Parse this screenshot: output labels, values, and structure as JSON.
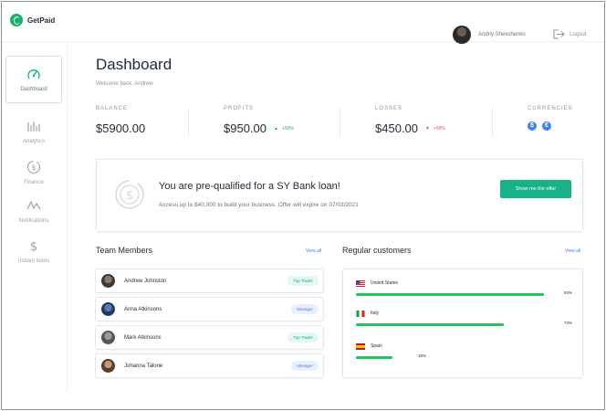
{
  "brand": {
    "name": "GetPaid"
  },
  "user": {
    "name": "Andriy Shevchenko"
  },
  "header": {
    "logout_label": "Logout"
  },
  "sidebar": {
    "items": [
      {
        "label": "Dashboard",
        "icon": "gauge-icon",
        "active": true
      },
      {
        "label": "Analytics",
        "icon": "bar-chart-icon"
      },
      {
        "label": "Finance",
        "icon": "dollar-circle-icon"
      },
      {
        "label": "Notifications",
        "icon": "pulse-icon"
      },
      {
        "label": "Instant loans",
        "icon": "dollar-icon"
      }
    ]
  },
  "page": {
    "title": "Dashboard",
    "subtitle": "Welcome back, Andrew"
  },
  "stats": {
    "balance": {
      "label": "Balance",
      "value": "$5900.00"
    },
    "profits": {
      "label": "Profits",
      "value": "$950.00",
      "delta": "+50%"
    },
    "losses": {
      "label": "Losses",
      "value": "$450.00",
      "delta": "+50%"
    },
    "currencies": {
      "label": "Currencies",
      "items": [
        "$",
        "€"
      ]
    }
  },
  "loan": {
    "title": "You are pre-qualified for a SY Bank loan!",
    "text": "Access up to $40,000 to build your business. Offer will expire on 07/03/2021",
    "button": "Show me the offer"
  },
  "team": {
    "title": "Team Members",
    "view_all": "View all",
    "members": [
      {
        "name": "Andrew Johnston",
        "badge": "Top Trader",
        "badge_color": "green"
      },
      {
        "name": "Anna Atkinsons",
        "badge": "Manager",
        "badge_color": "blue"
      },
      {
        "name": "Mark Atkinsons",
        "badge": "Top Trader",
        "badge_color": "green"
      },
      {
        "name": "Johanna Talone",
        "badge": "Manager",
        "badge_color": "blue"
      }
    ]
  },
  "customers": {
    "title": "Regular customers",
    "view_all": "View all",
    "items": [
      {
        "country": "United States",
        "percent": "93%",
        "value": 0.93
      },
      {
        "country": "Italy",
        "percent": "73%",
        "value": 0.73
      },
      {
        "country": "Spain",
        "percent": "18%",
        "value": 0.18
      }
    ]
  },
  "colors": {
    "accent": "#17b288",
    "bar": "#22c55e",
    "link": "#3b82f6",
    "loss": "#e54867"
  }
}
